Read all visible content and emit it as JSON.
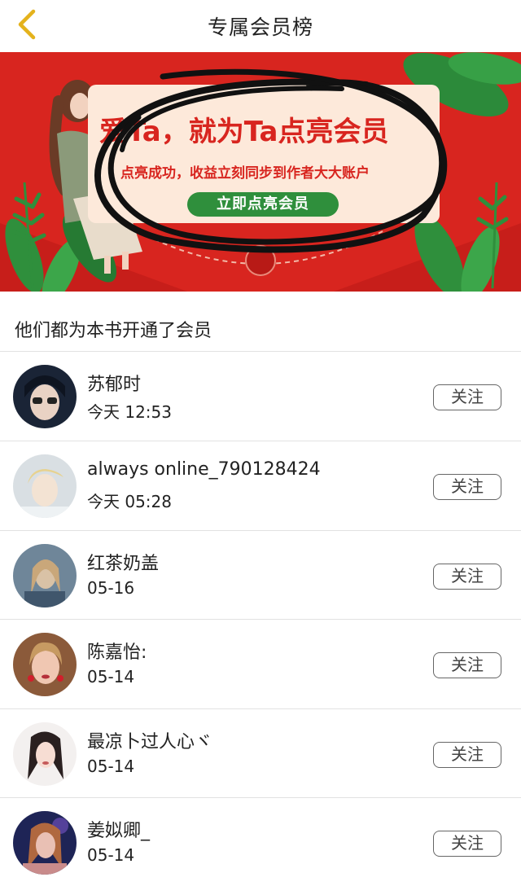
{
  "header": {
    "title": "专属会员榜",
    "back_icon": "chevron-left-icon",
    "accent_color": "#e4b21c"
  },
  "banner": {
    "headline": "爱Ta，就为Ta点亮会员",
    "subline": "点亮成功，收益立刻同步到作者大大账户",
    "cta_label": "立即点亮会员",
    "bg_color": "#d8251f",
    "cta_color": "#2f8f3c"
  },
  "members_section": {
    "title": "他们都为本书开通了会员",
    "follow_label": "关注",
    "rows": [
      {
        "name": "苏郁时",
        "time": "今天 12:53",
        "avatar_colors": [
          "#1a2436",
          "#e9d2c4"
        ]
      },
      {
        "name": "always online_790128424",
        "time": "今天 05:28",
        "avatar_colors": [
          "#d9dfe3",
          "#f3e3d3"
        ]
      },
      {
        "name": "红茶奶盖",
        "time": "05-16",
        "avatar_colors": [
          "#40566c",
          "#d9c2a6"
        ]
      },
      {
        "name": "陈嘉怡:",
        "time": "05-14",
        "avatar_colors": [
          "#8b5a3a",
          "#f0c7b2"
        ]
      },
      {
        "name": "最凉卜过人心ヾ",
        "time": "05-14",
        "avatar_colors": [
          "#f3f0ef",
          "#2a2020"
        ]
      },
      {
        "name": "姜姒卿_",
        "time": "05-14",
        "avatar_colors": [
          "#1e2456",
          "#c98b8b"
        ]
      }
    ]
  }
}
